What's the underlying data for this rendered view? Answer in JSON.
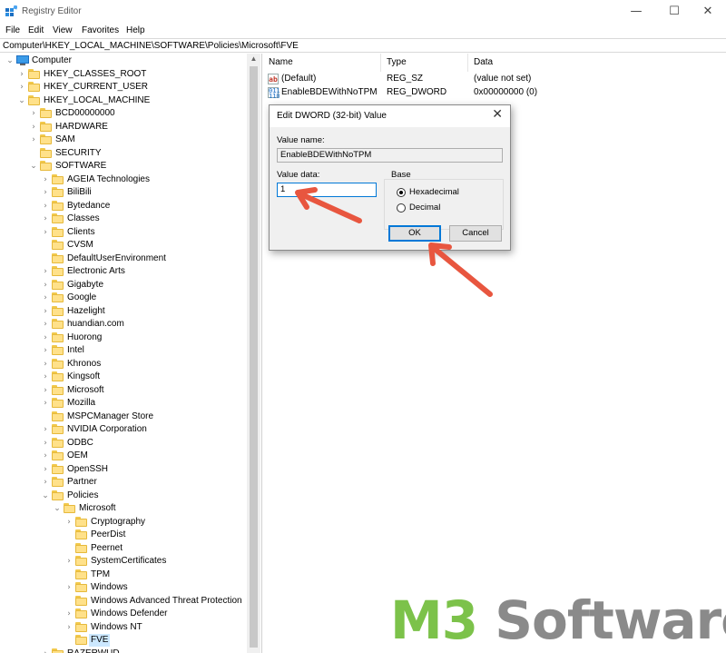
{
  "window": {
    "title": "Registry Editor",
    "controls": {
      "minimize": "—",
      "maximize": "☐",
      "close": "✕"
    }
  },
  "menu": [
    "File",
    "Edit",
    "View",
    "Favorites",
    "Help"
  ],
  "address": "Computer\\HKEY_LOCAL_MACHINE\\SOFTWARE\\Policies\\Microsoft\\FVE",
  "tree": [
    {
      "label": "Computer",
      "depth": 0,
      "expanded": true,
      "icon": "computer-icon"
    },
    {
      "label": "HKEY_CLASSES_ROOT",
      "depth": 1,
      "expanded": false
    },
    {
      "label": "HKEY_CURRENT_USER",
      "depth": 1,
      "expanded": false
    },
    {
      "label": "HKEY_LOCAL_MACHINE",
      "depth": 1,
      "expanded": true
    },
    {
      "label": "BCD00000000",
      "depth": 2,
      "expanded": false
    },
    {
      "label": "HARDWARE",
      "depth": 2,
      "expanded": false
    },
    {
      "label": "SAM",
      "depth": 2,
      "expanded": false
    },
    {
      "label": "SECURITY",
      "depth": 2,
      "expanded": null
    },
    {
      "label": "SOFTWARE",
      "depth": 2,
      "expanded": true
    },
    {
      "label": "AGEIA Technologies",
      "depth": 3,
      "expanded": false
    },
    {
      "label": "BiliBili",
      "depth": 3,
      "expanded": false
    },
    {
      "label": "Bytedance",
      "depth": 3,
      "expanded": false
    },
    {
      "label": "Classes",
      "depth": 3,
      "expanded": false
    },
    {
      "label": "Clients",
      "depth": 3,
      "expanded": false
    },
    {
      "label": "CVSM",
      "depth": 3,
      "expanded": null
    },
    {
      "label": "DefaultUserEnvironment",
      "depth": 3,
      "expanded": null
    },
    {
      "label": "Electronic Arts",
      "depth": 3,
      "expanded": false
    },
    {
      "label": "Gigabyte",
      "depth": 3,
      "expanded": false
    },
    {
      "label": "Google",
      "depth": 3,
      "expanded": false
    },
    {
      "label": "Hazelight",
      "depth": 3,
      "expanded": false
    },
    {
      "label": "huandian.com",
      "depth": 3,
      "expanded": false
    },
    {
      "label": "Huorong",
      "depth": 3,
      "expanded": false
    },
    {
      "label": "Intel",
      "depth": 3,
      "expanded": false
    },
    {
      "label": "Khronos",
      "depth": 3,
      "expanded": false
    },
    {
      "label": "Kingsoft",
      "depth": 3,
      "expanded": false
    },
    {
      "label": "Microsoft",
      "depth": 3,
      "expanded": false
    },
    {
      "label": "Mozilla",
      "depth": 3,
      "expanded": false
    },
    {
      "label": "MSPCManager Store",
      "depth": 3,
      "expanded": null
    },
    {
      "label": "NVIDIA Corporation",
      "depth": 3,
      "expanded": false
    },
    {
      "label": "ODBC",
      "depth": 3,
      "expanded": false
    },
    {
      "label": "OEM",
      "depth": 3,
      "expanded": false
    },
    {
      "label": "OpenSSH",
      "depth": 3,
      "expanded": false
    },
    {
      "label": "Partner",
      "depth": 3,
      "expanded": false
    },
    {
      "label": "Policies",
      "depth": 3,
      "expanded": true
    },
    {
      "label": "Microsoft",
      "depth": 4,
      "expanded": true
    },
    {
      "label": "Cryptography",
      "depth": 5,
      "expanded": false
    },
    {
      "label": "PeerDist",
      "depth": 5,
      "expanded": null
    },
    {
      "label": "Peernet",
      "depth": 5,
      "expanded": null
    },
    {
      "label": "SystemCertificates",
      "depth": 5,
      "expanded": false
    },
    {
      "label": "TPM",
      "depth": 5,
      "expanded": null
    },
    {
      "label": "Windows",
      "depth": 5,
      "expanded": false
    },
    {
      "label": "Windows Advanced Threat Protection",
      "depth": 5,
      "expanded": null
    },
    {
      "label": "Windows Defender",
      "depth": 5,
      "expanded": false
    },
    {
      "label": "Windows NT",
      "depth": 5,
      "expanded": false
    },
    {
      "label": "FVE",
      "depth": 5,
      "expanded": null,
      "selected": true
    },
    {
      "label": "RAZERWUD",
      "depth": 3,
      "expanded": false
    }
  ],
  "values_pane": {
    "columns": {
      "name": "Name",
      "type": "Type",
      "data": "Data"
    },
    "rows": [
      {
        "name": "(Default)",
        "type": "REG_SZ",
        "data": "(value not set)",
        "icon": "string-value-icon"
      },
      {
        "name": "EnableBDEWithNoTPM",
        "type": "REG_DWORD",
        "data": "0x00000000 (0)",
        "icon": "binary-value-icon"
      }
    ]
  },
  "dialog": {
    "title": "Edit DWORD (32-bit) Value",
    "close": "✕",
    "value_name_label": "Value name:",
    "value_name": "EnableBDEWithNoTPM",
    "value_data_label": "Value data:",
    "value_data": "1",
    "base_label": "Base",
    "base_options": [
      {
        "label": "Hexadecimal",
        "checked": true
      },
      {
        "label": "Decimal",
        "checked": false
      }
    ],
    "ok_label": "OK",
    "cancel_label": "Cancel"
  },
  "annotation_color": "#e8563f",
  "watermark": {
    "part1": "M3",
    "part2": " Software",
    "color_green": "#7cc24a",
    "color_gray": "#8a8a8a"
  }
}
